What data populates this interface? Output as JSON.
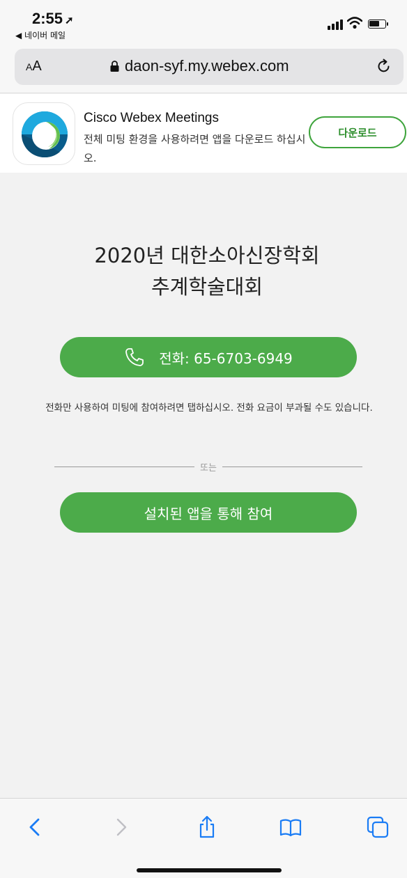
{
  "status_bar": {
    "time": "2:55",
    "back_app_label": "◀ 네이버 메일"
  },
  "browser": {
    "text_size_label_small": "A",
    "text_size_label_large": "A",
    "url": "daon-syf.my.webex.com"
  },
  "app_banner": {
    "app_name": "Cisco Webex Meetings",
    "description": "전체 미팅 환경을 사용하려면 앱을 다운로드 하십시오.",
    "download_label": "다운로드"
  },
  "meeting": {
    "title_line1": "2020년 대한소아신장학회",
    "title_line2": "추계학술대회",
    "call_label": "전화: 65-6703-6949",
    "note": "전화만 사용하여 미팅에 참여하려면 탭하십시오. 전화 요금이 부과될 수도 있습니다.",
    "or_label": "또는",
    "join_app_label": "설치된 앱을 통해 참여"
  },
  "colors": {
    "accent_green": "#4cab4a",
    "ios_blue": "#1a7cf5"
  },
  "toolbar": {
    "icons": [
      "back-icon",
      "forward-icon",
      "share-icon",
      "bookmarks-icon",
      "tabs-icon"
    ]
  }
}
